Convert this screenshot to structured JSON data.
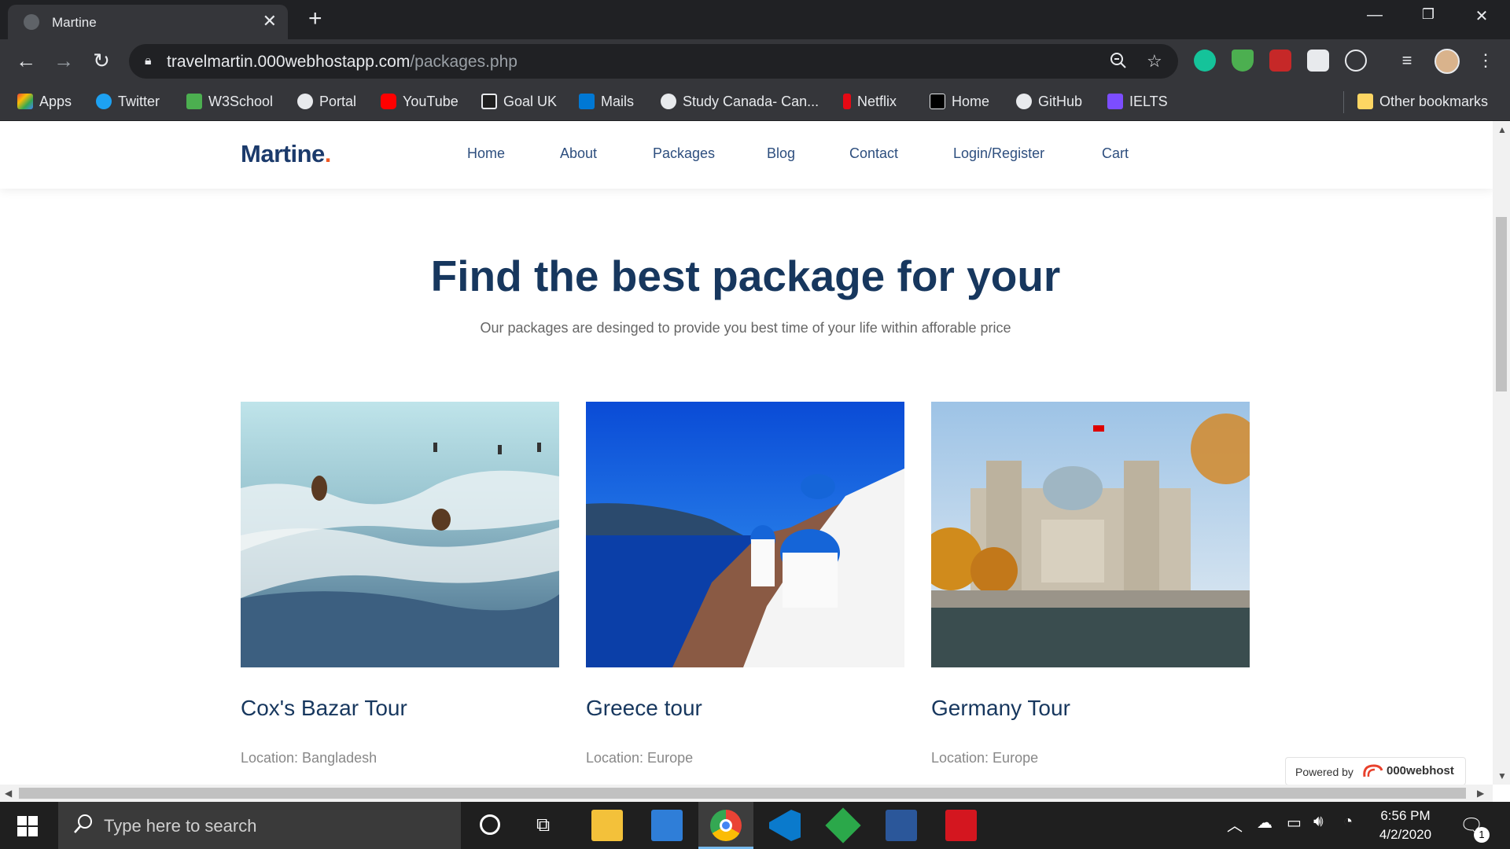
{
  "browser": {
    "tab_title": "Martine",
    "url_host": "travelmartin.000webhostapp.com",
    "url_path": "/packages.php",
    "bookmarks": [
      {
        "label": "Apps",
        "color": "#ea4335"
      },
      {
        "label": "Twitter",
        "color": "#1da1f2"
      },
      {
        "label": "W3School",
        "color": "#4caf50"
      },
      {
        "label": "Portal",
        "color": "#e8eaed"
      },
      {
        "label": "YouTube",
        "color": "#ff0000"
      },
      {
        "label": "Goal UK",
        "color": "#e8eaed"
      },
      {
        "label": "Mails",
        "color": "#0078d4"
      },
      {
        "label": "Study Canada- Can...",
        "color": "#e8eaed"
      },
      {
        "label": "Netflix",
        "color": "#e50914"
      },
      {
        "label": "Home",
        "color": "#e8eaed"
      },
      {
        "label": "GitHub",
        "color": "#e8eaed"
      },
      {
        "label": "IELTS",
        "color": "#7c4dff"
      }
    ],
    "other_bookmarks": "Other bookmarks"
  },
  "site": {
    "logo": "Martine",
    "logo_dot": ".",
    "nav": [
      "Home",
      "About",
      "Packages",
      "Blog",
      "Contact",
      "Login/Register",
      "Cart"
    ],
    "hero_title": "Find the best package for your",
    "hero_subtitle": "Our packages are desinged to provide you best time of your life within afforable price",
    "packages": [
      {
        "title": "Cox's Bazar Tour",
        "location": "Location: Bangladesh"
      },
      {
        "title": "Greece tour",
        "location": "Location: Europe"
      },
      {
        "title": "Germany Tour",
        "location": "Location: Europe"
      }
    ],
    "powered_by": "Powered by",
    "powered_brand": "000webhost"
  },
  "taskbar": {
    "search_placeholder": "Type here to search",
    "time": "6:56 PM",
    "date": "4/2/2020",
    "notification_count": "1"
  }
}
